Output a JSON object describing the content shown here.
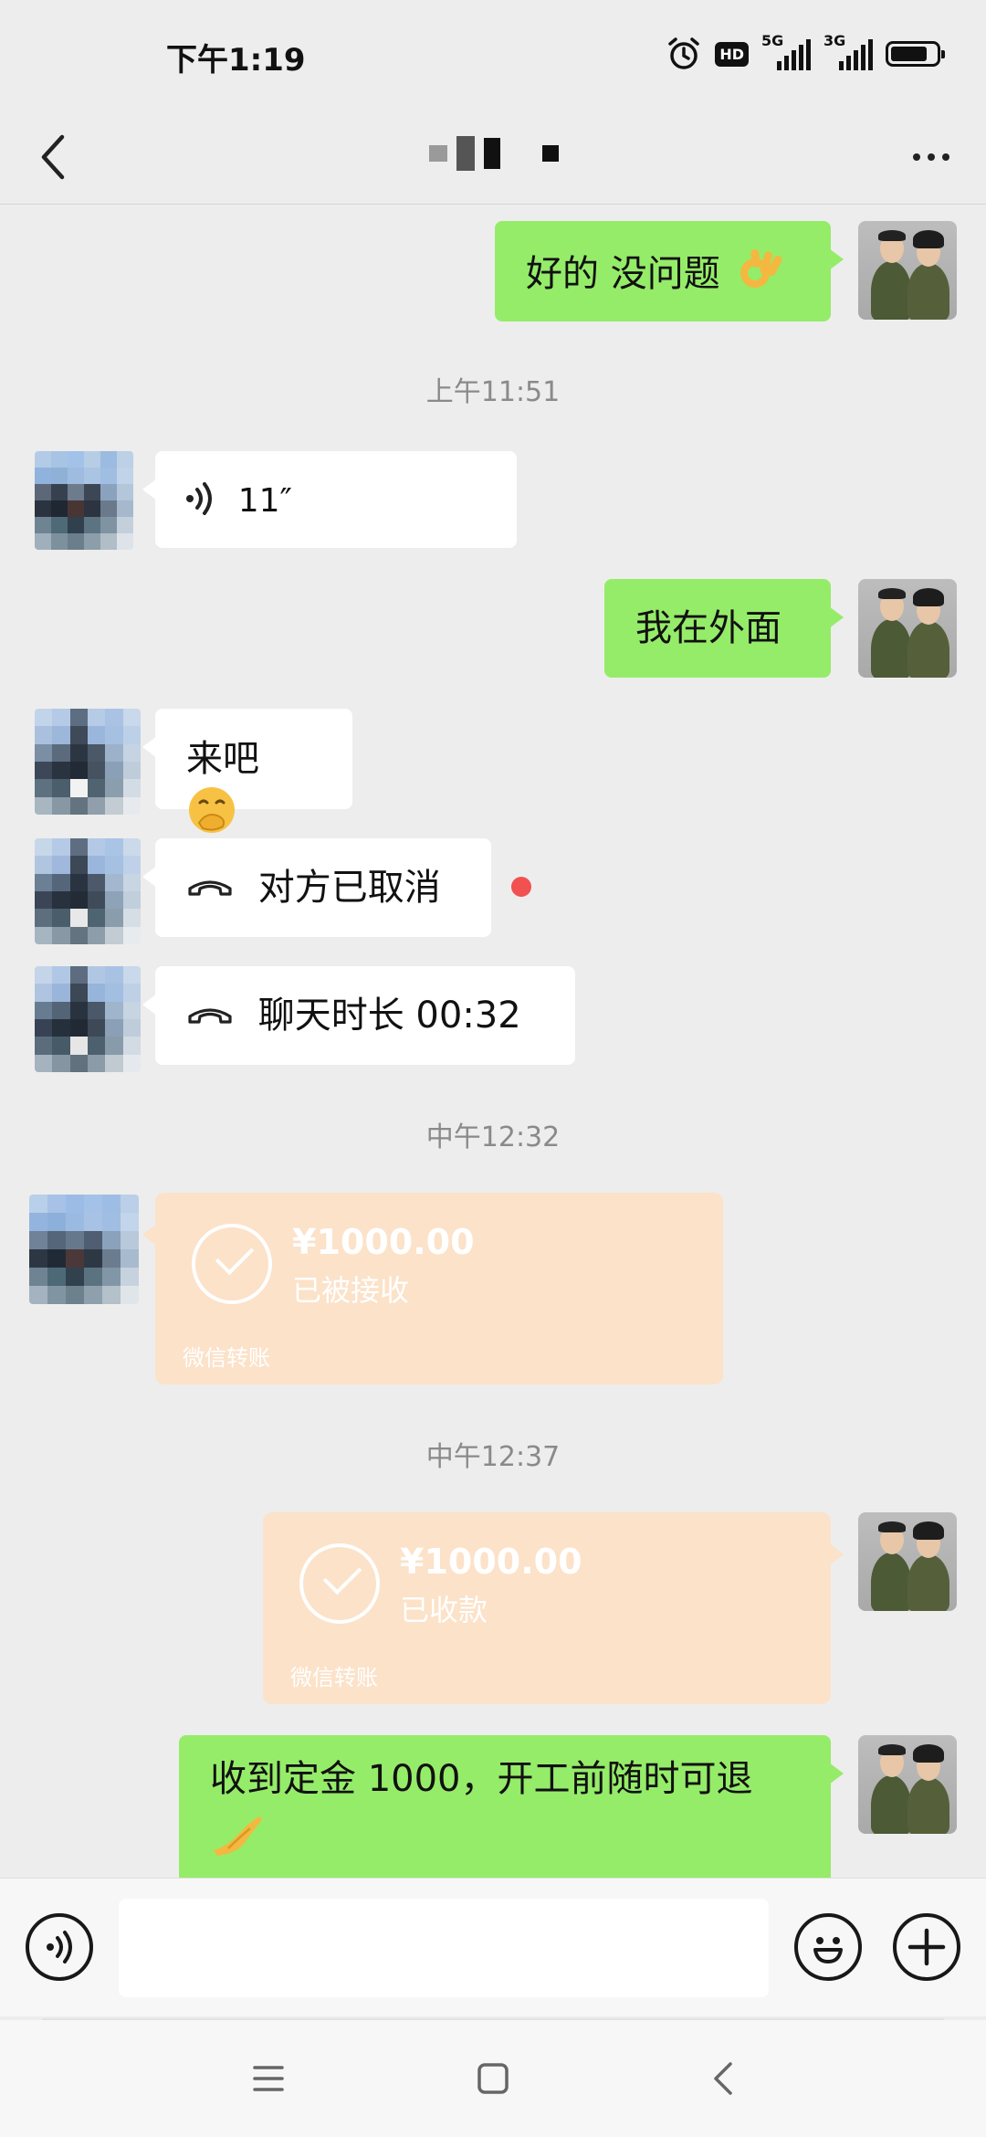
{
  "status_bar": {
    "time": "下午1:19",
    "hd": "HD",
    "sig1_label": "5G",
    "sig2_label": "3G"
  },
  "header": {
    "title": ""
  },
  "messages": [
    {
      "side": "self",
      "type": "text",
      "text": "好的 没问题",
      "emoji": "ok-hand"
    },
    {
      "type": "timestamp",
      "text": "上午11:51"
    },
    {
      "side": "other",
      "type": "voice",
      "text": "11″"
    },
    {
      "side": "self",
      "type": "text",
      "text": "我在外面"
    },
    {
      "side": "other",
      "type": "text",
      "text": "来吧",
      "emoji": "face-with-hand-over-mouth"
    },
    {
      "side": "other",
      "type": "call",
      "text": "对方已取消",
      "unread": true
    },
    {
      "side": "other",
      "type": "call",
      "text": "聊天时长 00:32"
    },
    {
      "type": "timestamp",
      "text": "中午12:32"
    },
    {
      "side": "other",
      "type": "transfer",
      "amount": "¥1000.00",
      "status": "已被接收",
      "footer": "微信转账"
    },
    {
      "type": "timestamp",
      "text": "中午12:37"
    },
    {
      "side": "self",
      "type": "transfer",
      "amount": "¥1000.00",
      "status": "已收款",
      "footer": "微信转账"
    },
    {
      "side": "self",
      "type": "text",
      "text": "收到定金 1000，开工前随时可退",
      "emoji": "pinching-hand"
    }
  ],
  "input_bar": {
    "value": "",
    "voice_icon": "voice-input-icon",
    "emoji_icon": "emoji-icon",
    "plus_icon": "plus-icon"
  },
  "nav_bar": {
    "menu_icon": "menu-icon",
    "home_icon": "home-icon",
    "back_icon": "back-icon"
  },
  "colors": {
    "background": "#EDEDED",
    "self_bubble": "#95EC69",
    "other_bubble": "#FFFFFF",
    "transfer_card": "#FBE2C9",
    "unread_dot": "#F15150",
    "timestamp_text": "#8A8A8A"
  }
}
